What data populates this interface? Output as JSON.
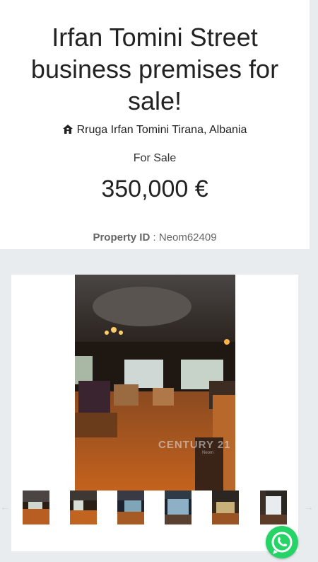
{
  "listing": {
    "title_line1": "Irfan Tomini Street",
    "title_line2": "business premises for",
    "title_line3": "sale!",
    "address": "Rruga Irfan Tomini Tirana, Albania",
    "status": "For Sale",
    "price": "350,000 €",
    "property_id_label": "Property ID",
    "property_id_sep": " : ",
    "property_id_value": "Neom62409"
  },
  "gallery": {
    "watermark": "CENTURY 21",
    "watermark_sub": "Neom",
    "thumbnail_count": 6,
    "prev_icon": "arrow-left-icon",
    "next_icon": "arrow-right-icon"
  },
  "colors": {
    "background": "#e9ecef",
    "card": "#ffffff",
    "whatsapp": "#25d366"
  },
  "icons": {
    "address": "home-icon",
    "chat": "whatsapp-icon"
  }
}
